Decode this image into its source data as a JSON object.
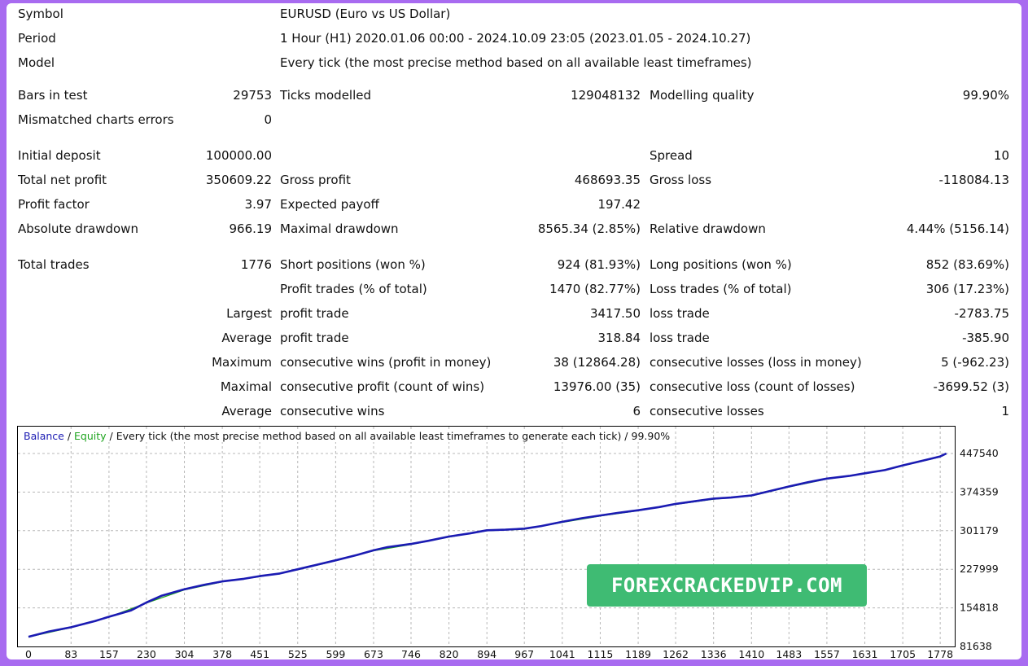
{
  "header": {
    "symbol_label": "Symbol",
    "symbol_value": "EURUSD (Euro vs US Dollar)",
    "period_label": "Period",
    "period_value": "1 Hour (H1) 2020.01.06 00:00 - 2024.10.09 23:05 (2023.01.05 - 2024.10.27)",
    "model_label": "Model",
    "model_value": "Every tick (the most precise method based on all available least timeframes)"
  },
  "test": {
    "bars_label": "Bars in test",
    "bars_value": "29753",
    "ticks_label": "Ticks modelled",
    "ticks_value": "129048132",
    "quality_label": "Modelling quality",
    "quality_value": "99.90%",
    "mismatch_label": "Mismatched charts errors",
    "mismatch_value": "0"
  },
  "results": {
    "deposit_label": "Initial deposit",
    "deposit_value": "100000.00",
    "spread_label": "Spread",
    "spread_value": "10",
    "netprofit_label": "Total net profit",
    "netprofit_value": "350609.22",
    "grossprofit_label": "Gross profit",
    "grossprofit_value": "468693.35",
    "grossloss_label": "Gross loss",
    "grossloss_value": "-118084.13",
    "pf_label": "Profit factor",
    "pf_value": "3.97",
    "payoff_label": "Expected payoff",
    "payoff_value": "197.42",
    "absdd_label": "Absolute drawdown",
    "absdd_value": "966.19",
    "maxdd_label": "Maximal drawdown",
    "maxdd_value": "8565.34 (2.85%)",
    "reldd_label": "Relative drawdown",
    "reldd_value": "4.44% (5156.14)"
  },
  "trades": {
    "total_label": "Total trades",
    "total_value": "1776",
    "short_label": "Short positions (won %)",
    "short_value": "924 (81.93%)",
    "long_label": "Long positions (won %)",
    "long_value": "852 (83.69%)",
    "profit_trades_label": "Profit trades (% of total)",
    "profit_trades_value": "1470 (82.77%)",
    "loss_trades_label": "Loss trades (% of total)",
    "loss_trades_value": "306 (17.23%)",
    "largest_prefix": "Largest",
    "largest_profit_label": "profit trade",
    "largest_profit_value": "3417.50",
    "largest_loss_label": "loss trade",
    "largest_loss_value": "-2783.75",
    "average_prefix": "Average",
    "avg_profit_label": "profit trade",
    "avg_profit_value": "318.84",
    "avg_loss_label": "loss trade",
    "avg_loss_value": "-385.90",
    "maximum_prefix": "Maximum",
    "max_wins_label": "consecutive wins (profit in money)",
    "max_wins_value": "38 (12864.28)",
    "max_losses_label": "consecutive losses (loss in money)",
    "max_losses_value": "5 (-962.23)",
    "maximal_prefix": "Maximal",
    "maximal_profit_label": "consecutive profit (count of wins)",
    "maximal_profit_value": "13976.00 (35)",
    "maximal_loss_label": "consecutive loss (count of losses)",
    "maximal_loss_value": "-3699.52 (3)",
    "average2_prefix": "Average",
    "avg_wins_label": "consecutive wins",
    "avg_wins_value": "6",
    "avg_losses_label": "consecutive losses",
    "avg_losses_value": "1"
  },
  "chart_legend": {
    "balance": "Balance",
    "sep1": " / ",
    "equity": "Equity",
    "rest": " / Every tick (the most precise method based on all available least timeframes to generate each tick) / 99.90%"
  },
  "watermark": "FOREXCRACKEDVIP.COM",
  "chart_data": {
    "type": "line",
    "xlabel": "",
    "ylabel": "",
    "x_ticks": [
      "0",
      "83",
      "157",
      "230",
      "304",
      "378",
      "451",
      "525",
      "599",
      "673",
      "746",
      "820",
      "894",
      "967",
      "1041",
      "1115",
      "1189",
      "1262",
      "1336",
      "1410",
      "1483",
      "1557",
      "1631",
      "1705",
      "1778"
    ],
    "y_ticks": [
      "447540",
      "374359",
      "301179",
      "227999",
      "154818",
      "81638"
    ],
    "xlim": [
      0,
      1800
    ],
    "ylim": [
      81638,
      447540
    ],
    "grid": true,
    "colors": {
      "balance": "#1b1bb3",
      "equity": "#1fa51f"
    },
    "series": [
      {
        "name": "Balance",
        "x": [
          0,
          40,
          83,
          130,
          157,
          200,
          230,
          260,
          304,
          340,
          378,
          420,
          451,
          490,
          525,
          560,
          599,
          640,
          673,
          700,
          746,
          780,
          820,
          860,
          894,
          930,
          967,
          1000,
          1041,
          1080,
          1115,
          1150,
          1189,
          1230,
          1262,
          1300,
          1336,
          1370,
          1410,
          1440,
          1483,
          1520,
          1557,
          1600,
          1631,
          1670,
          1705,
          1740,
          1778,
          1790
        ],
        "y": [
          100000,
          110000,
          118000,
          130000,
          138000,
          150000,
          165000,
          178000,
          190000,
          198000,
          205000,
          210000,
          215000,
          220000,
          228000,
          236000,
          245000,
          255000,
          264000,
          270000,
          276000,
          282000,
          290000,
          296000,
          302000,
          303000,
          305000,
          310000,
          318000,
          325000,
          330000,
          335000,
          340000,
          346000,
          352000,
          357000,
          362000,
          364000,
          368000,
          375000,
          385000,
          393000,
          400000,
          405000,
          410000,
          416000,
          425000,
          433000,
          442000,
          447540
        ]
      },
      {
        "name": "Equity",
        "x": [
          0,
          83,
          157,
          230,
          304,
          378,
          451,
          525,
          599,
          673,
          746,
          820,
          894,
          967,
          1041,
          1115,
          1189,
          1262,
          1336,
          1410,
          1483,
          1557,
          1631,
          1705,
          1778,
          1790
        ],
        "y": [
          99500,
          117500,
          137500,
          164000,
          189000,
          204000,
          214000,
          227000,
          244000,
          263000,
          275000,
          289000,
          301000,
          304000,
          317000,
          329000,
          339000,
          351000,
          361000,
          367000,
          384000,
          399000,
          409000,
          424000,
          441000,
          447000
        ]
      }
    ]
  }
}
